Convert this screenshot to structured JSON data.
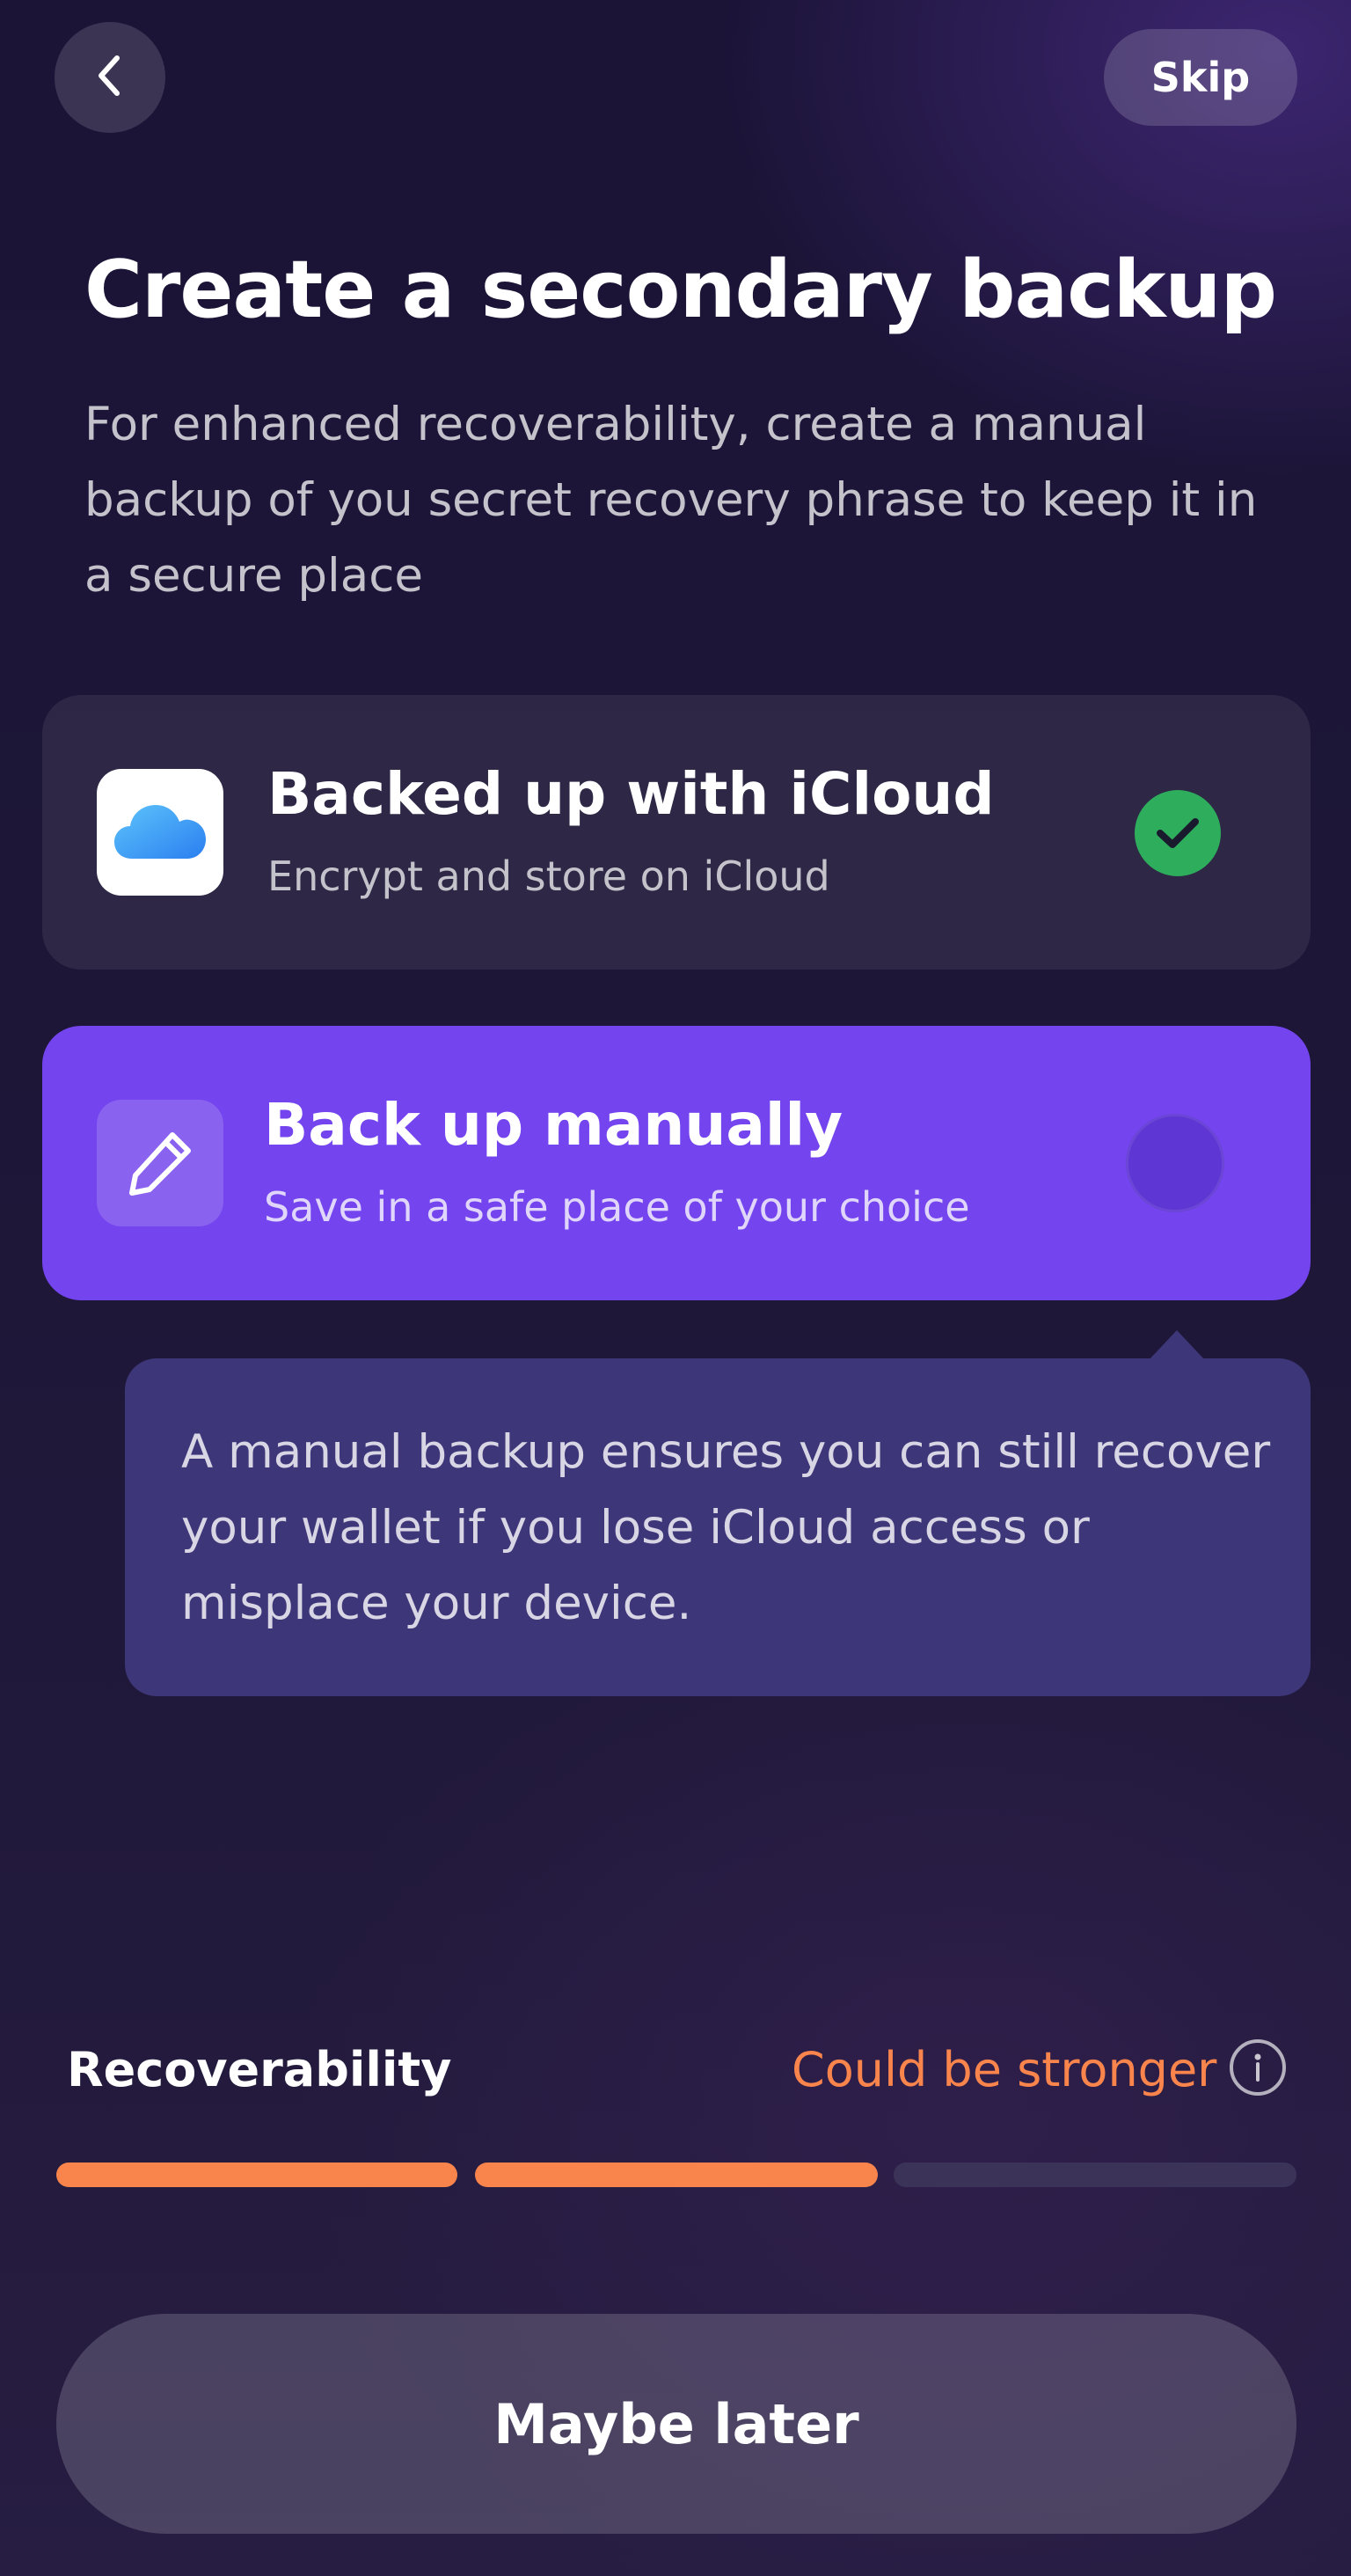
{
  "header": {
    "back_icon": "chevron-left-icon",
    "skip_label": "Skip"
  },
  "title": "Create a secondary backup",
  "subtitle": "For enhanced recoverability, create a manual backup of you secret recovery phrase to keep it in a secure place",
  "options": [
    {
      "icon": "icloud-icon",
      "title": "Backed up with iCloud",
      "subtitle": "Encrypt and store on iCloud",
      "selected": true,
      "state_icon": "checkmark-icon"
    },
    {
      "icon": "pencil-icon",
      "title": "Back up manually",
      "subtitle": "Save in a safe place of your choice",
      "selected": false,
      "state_icon": "radio-unselected"
    }
  ],
  "tooltip": {
    "text": "A manual backup ensures you can still recover your wallet if you lose iCloud access or misplace your device."
  },
  "recoverability": {
    "label": "Recoverability",
    "status": "Could be stronger",
    "info_icon": "info-icon",
    "filled_segments": 2,
    "total_segments": 3
  },
  "footer": {
    "maybe_later_label": "Maybe later"
  },
  "colors": {
    "accent": "#7444ee",
    "success": "#2eae5c",
    "warning": "#f9854d",
    "segment_empty": "#3b3458",
    "background": "#1d1637"
  }
}
